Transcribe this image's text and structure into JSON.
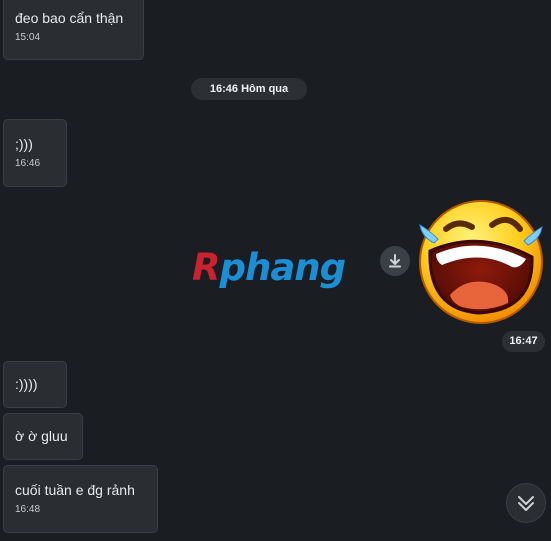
{
  "messages": [
    {
      "text": "đeo bao cẩn thận",
      "time": "15:04"
    },
    {
      "text": ";)))",
      "time": "16:46"
    },
    {
      "text": ":))))"
    },
    {
      "text": "ờ ờ gluu"
    },
    {
      "text": "cuối tuần e đg rảnh",
      "time": "16:48"
    }
  ],
  "date_separator": "16:46 Hôm qua",
  "watermark": {
    "first_letter": "R",
    "rest": "phang"
  },
  "sticker": {
    "icon": "laughing-emoji-sticker",
    "time": "16:47"
  },
  "icons": {
    "download": "download-icon",
    "scroll": "double-chevron-down-icon"
  },
  "colors": {
    "background": "#1a1d21",
    "bubble": "#2a2e33",
    "bubble_border": "#3a3f45",
    "pill": "#2c3035",
    "watermark_red": "#c8232e",
    "watermark_blue": "#1a8fd6"
  }
}
